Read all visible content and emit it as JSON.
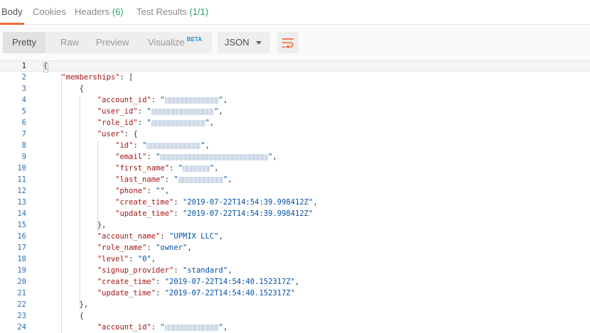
{
  "tabs": [
    {
      "label": "Body",
      "count": ""
    },
    {
      "label": "Cookies",
      "count": ""
    },
    {
      "label": "Headers",
      "count": "(6)"
    },
    {
      "label": "Test Results",
      "count": "(1/1)"
    }
  ],
  "toolbar": {
    "views": [
      "Pretty",
      "Raw",
      "Preview",
      "Visualize"
    ],
    "beta": "BETA",
    "format": "JSON"
  },
  "lines": [
    {
      "n": "1",
      "text": "{"
    },
    {
      "n": "2",
      "text": "    \"memberships\": ["
    },
    {
      "n": "3",
      "text": "        {"
    },
    {
      "n": "4",
      "text": "            \"account_id\": \"[redacted]\","
    },
    {
      "n": "5",
      "text": "            \"user_id\": \"[redacted]\","
    },
    {
      "n": "6",
      "text": "            \"role_id\": \"[redacted]\","
    },
    {
      "n": "7",
      "text": "            \"user\": {"
    },
    {
      "n": "8",
      "text": "                \"id\": \"[redacted]\","
    },
    {
      "n": "9",
      "text": "                \"email\": \"[redacted]\","
    },
    {
      "n": "10",
      "text": "                \"first_name\": \"[redacted]\","
    },
    {
      "n": "11",
      "text": "                \"last_name\": \"[redacted]\","
    },
    {
      "n": "12",
      "text": "                \"phone\": \"\","
    },
    {
      "n": "13",
      "text": "                \"create_time\": \"2019-07-22T14:54:39.998412Z\","
    },
    {
      "n": "14",
      "text": "                \"update_time\": \"2019-07-22T14:54:39.998412Z\""
    },
    {
      "n": "15",
      "text": "            },"
    },
    {
      "n": "16",
      "text": "            \"account_name\": \"UPMIX LLC\","
    },
    {
      "n": "17",
      "text": "            \"role_name\": \"owner\","
    },
    {
      "n": "18",
      "text": "            \"level\": \"0\","
    },
    {
      "n": "19",
      "text": "            \"signup_provider\": \"standard\","
    },
    {
      "n": "20",
      "text": "            \"create_time\": \"2019-07-22T14:54:40.152317Z\","
    },
    {
      "n": "21",
      "text": "            \"update_time\": \"2019-07-22T14:54:40.152317Z\""
    },
    {
      "n": "22",
      "text": "        },"
    },
    {
      "n": "23",
      "text": "        {"
    },
    {
      "n": "24",
      "text": "            \"account_id\": \"[redacted]\","
    }
  ]
}
